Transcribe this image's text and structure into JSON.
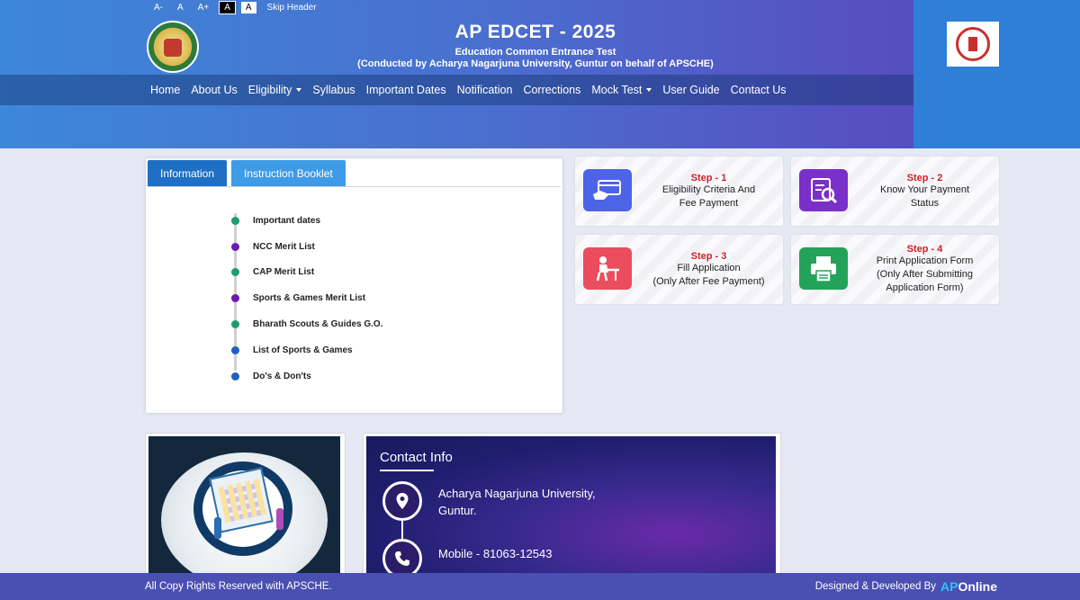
{
  "accessibility": {
    "font_decrease": "A-",
    "font_normal": "A",
    "font_increase": "A+",
    "theme_dark": "A",
    "theme_light": "A",
    "skip": "Skip Header"
  },
  "header": {
    "title": "AP EDCET - 2025",
    "subtitle": "Education Common Entrance Test",
    "conducted_by": "(Conducted by Acharya Nagarjuna University, Guntur on behalf of APSCHE)"
  },
  "nav": {
    "items": [
      {
        "label": "Home"
      },
      {
        "label": "About Us"
      },
      {
        "label": "Eligibility"
      },
      {
        "label": "Syllabus"
      },
      {
        "label": "Important Dates"
      },
      {
        "label": "Notification"
      },
      {
        "label": "Corrections"
      },
      {
        "label": "Mock Test"
      },
      {
        "label": "User Guide"
      },
      {
        "label": "Contact Us"
      }
    ]
  },
  "info": {
    "tabs": [
      {
        "label": "Information"
      },
      {
        "label": "Instruction Booklet"
      }
    ],
    "items": [
      {
        "label": "Important dates",
        "color": "#1e9c73"
      },
      {
        "label": "NCC Merit List",
        "color": "#6a1bb0"
      },
      {
        "label": "CAP Merit List",
        "color": "#1e9c73"
      },
      {
        "label": "Sports & Games Merit List",
        "color": "#6a1bb0"
      },
      {
        "label": "Bharath Scouts & Guides G.O.",
        "color": "#1e9c73"
      },
      {
        "label": "List of Sports & Games",
        "color": "#1f5fc4"
      },
      {
        "label": "Do's & Don'ts",
        "color": "#1f5fc4"
      }
    ]
  },
  "steps": [
    {
      "title": "Step - 1",
      "line1": "Eligibility Criteria And",
      "line2": "Fee Payment",
      "line3": "",
      "icon": "card-payment-icon",
      "color": "#4d63e8"
    },
    {
      "title": "Step - 2",
      "line1": "Know Your Payment",
      "line2": "Status",
      "line3": "",
      "icon": "search-document-icon",
      "color": "#7b2fc9"
    },
    {
      "title": "Step - 3",
      "line1": "Fill Application",
      "line2": "(Only After Fee Payment)",
      "line3": "",
      "icon": "person-writing-icon",
      "color": "#ea4d5e"
    },
    {
      "title": "Step - 4",
      "line1": "Print Application Form",
      "line2": "(Only After Submitting",
      "line3": "Application Form)",
      "icon": "printer-icon",
      "color": "#23a35a"
    }
  ],
  "contact": {
    "title": "Contact Info",
    "address_line1": "Acharya Nagarjuna University,",
    "address_line2": "Guntur.",
    "mobile": "Mobile - 81063-12543"
  },
  "footer": {
    "copyright": "All Copy Rights Reserved with APSCHE.",
    "designed_by": "Designed & Developed By",
    "brand_part1": "AP",
    "brand_part2": "Online"
  }
}
